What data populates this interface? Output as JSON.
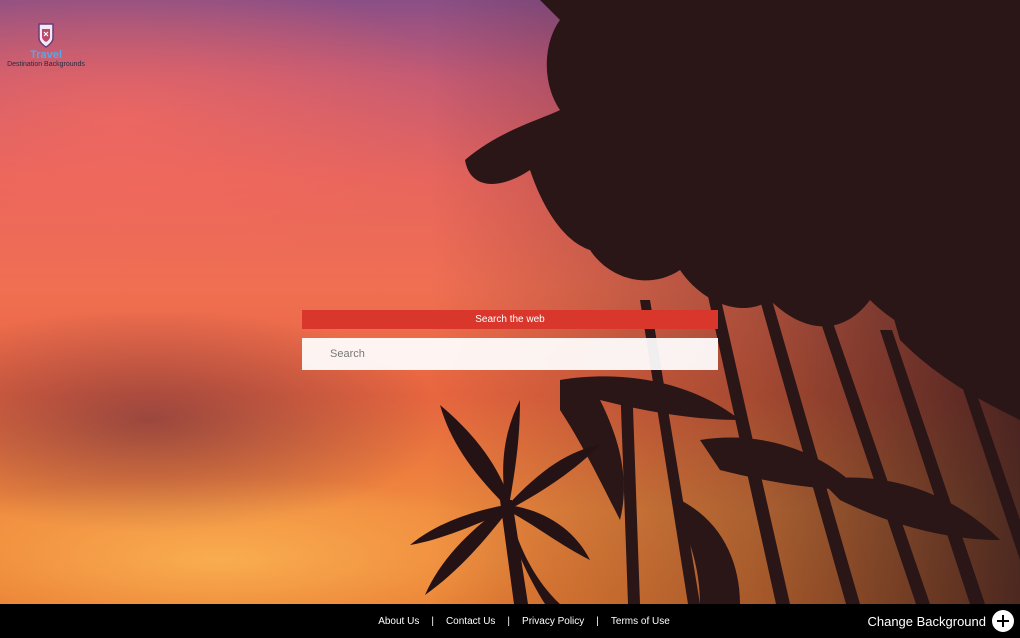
{
  "colors": {
    "accent": "#d9362c",
    "footer_bg": "#000000",
    "logo_title": "#5aa7e8"
  },
  "background": {
    "icon": "palm-trees-sunset-image"
  },
  "logo": {
    "icon": "crest-shield-icon",
    "title": "Travel",
    "subtitle": "Destination Backgrounds"
  },
  "search": {
    "title": "Search the web",
    "placeholder": "Search",
    "value": ""
  },
  "footer": {
    "links": [
      "About Us",
      "Contact Us",
      "Privacy Policy",
      "Terms of Use"
    ],
    "separator": "|",
    "change_background_label": "Change Background",
    "change_background_icon": "plus-icon"
  }
}
